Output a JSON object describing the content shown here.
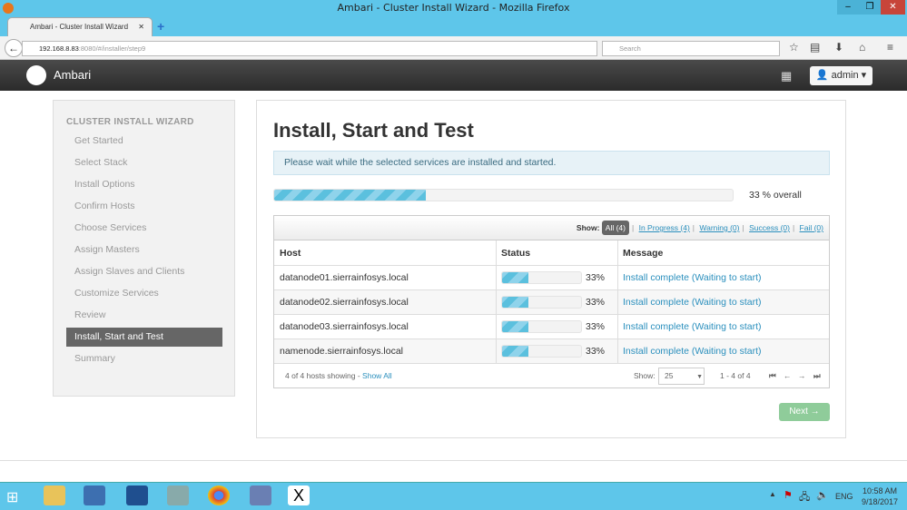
{
  "window": {
    "title": "Ambari - Cluster Install Wizard - Mozilla Firefox"
  },
  "browser": {
    "tab": "Ambari - Cluster Install Wizard",
    "url_host": "192.168.8.83",
    "url_rest": ":8080/#/installer/step9",
    "search_placeholder": "Search"
  },
  "app": {
    "brand": "Ambari",
    "user": "admin"
  },
  "sidebar": {
    "header": "CLUSTER INSTALL WIZARD",
    "items": [
      {
        "label": "Get Started"
      },
      {
        "label": "Select Stack"
      },
      {
        "label": "Install Options"
      },
      {
        "label": "Confirm Hosts"
      },
      {
        "label": "Choose Services"
      },
      {
        "label": "Assign Masters"
      },
      {
        "label": "Assign Slaves and Clients"
      },
      {
        "label": "Customize Services"
      },
      {
        "label": "Review"
      },
      {
        "label": "Install, Start and Test"
      },
      {
        "label": "Summary"
      }
    ],
    "active": 9
  },
  "main": {
    "title": "Install, Start and Test",
    "alert": "Please wait while the selected services are installed and started.",
    "overall_progress": 33,
    "overall_label": "33 % overall",
    "filter": {
      "label": "Show:",
      "all": "All (4)",
      "in_progress": "In Progress (4)",
      "warning": "Warning (0)",
      "success": "Success (0)",
      "fail": "Fail (0)"
    },
    "columns": [
      "Host",
      "Status",
      "Message"
    ],
    "rows": [
      {
        "host": "datanode01.sierrainfosys.local",
        "progress": 33,
        "pct": "33%",
        "message": "Install complete (Waiting to start)"
      },
      {
        "host": "datanode02.sierrainfosys.local",
        "progress": 33,
        "pct": "33%",
        "message": "Install complete (Waiting to start)"
      },
      {
        "host": "datanode03.sierrainfosys.local",
        "progress": 33,
        "pct": "33%",
        "message": "Install complete (Waiting to start)"
      },
      {
        "host": "namenode.sierrainfosys.local",
        "progress": 33,
        "pct": "33%",
        "message": "Install complete (Waiting to start)"
      }
    ],
    "footer": {
      "showing": "4 of 4 hosts showing - ",
      "show_all": "Show All",
      "show_label": "Show:",
      "page_size": "25",
      "range": "1 - 4 of 4"
    },
    "next": "Next →"
  },
  "taskbar": {
    "lang": "ENG",
    "time": "10:58 AM",
    "date": "9/18/2017"
  }
}
